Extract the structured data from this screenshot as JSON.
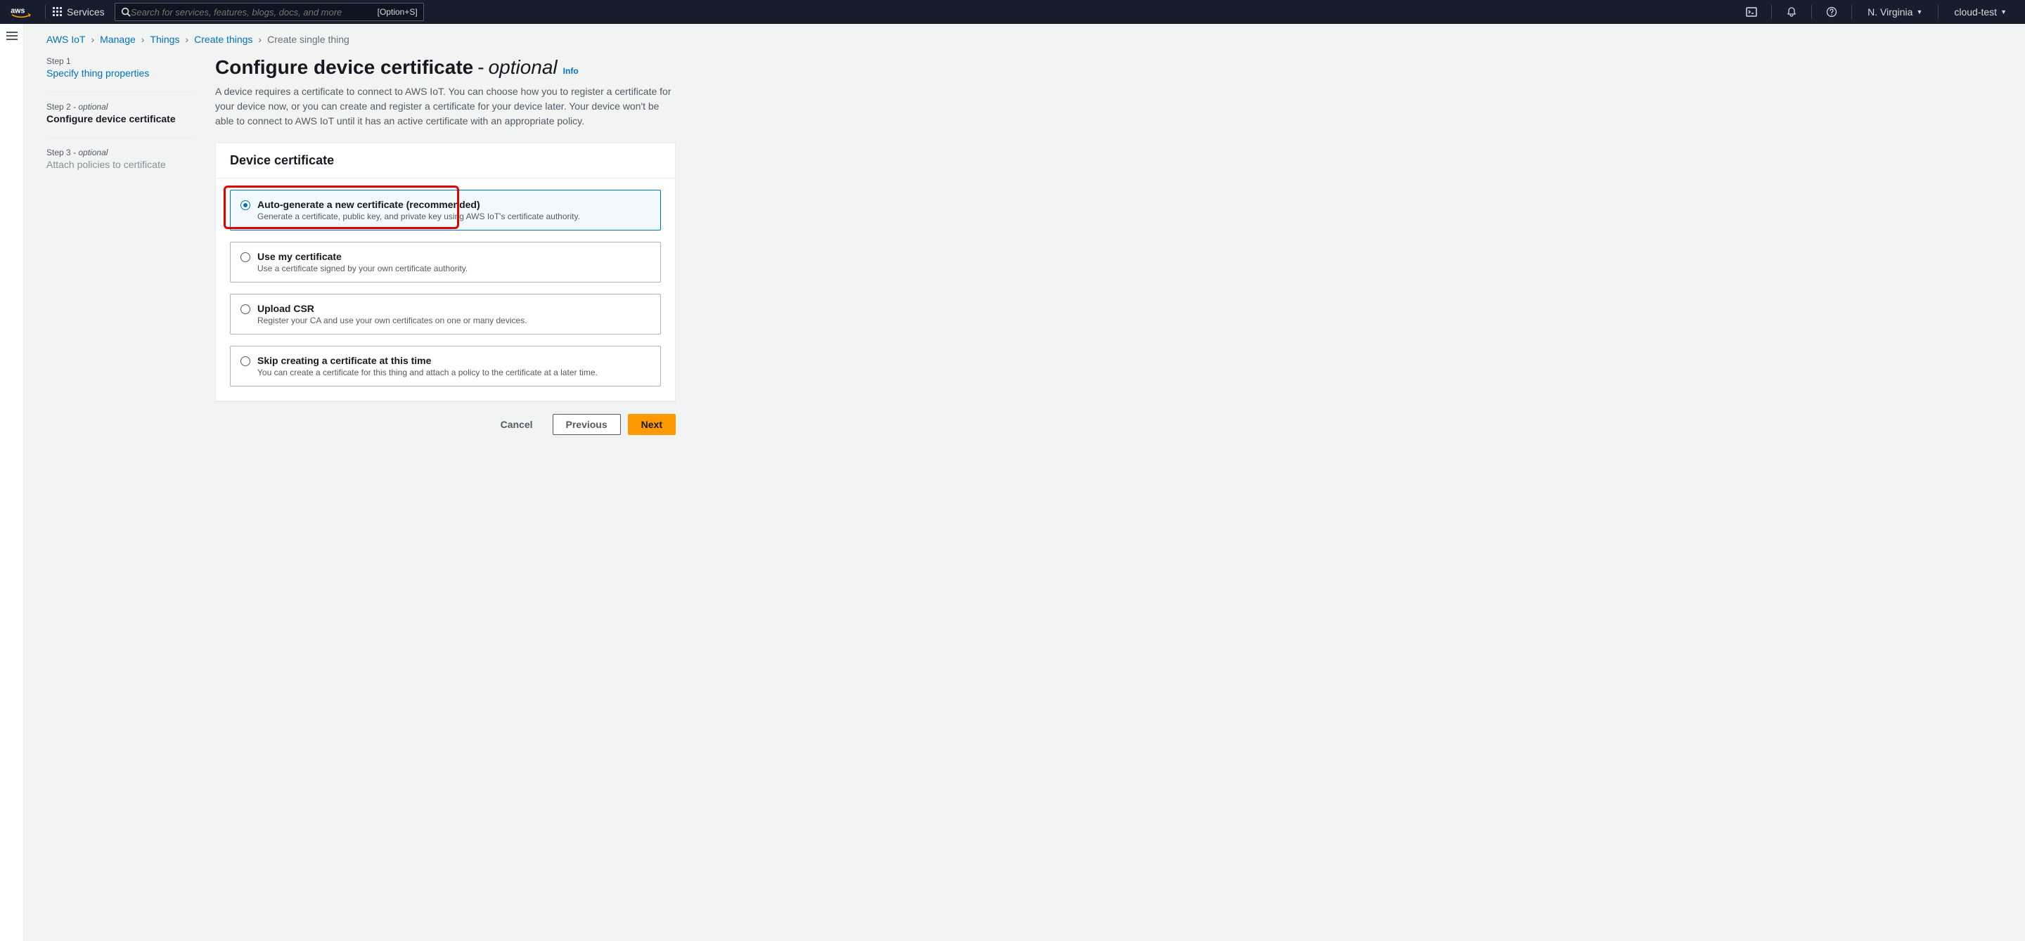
{
  "nav": {
    "services_label": "Services",
    "search_placeholder": "Search for services, features, blogs, docs, and more",
    "search_shortcut": "[Option+S]",
    "region": "N. Virginia",
    "account": "cloud-test"
  },
  "breadcrumbs": {
    "items": [
      "AWS IoT",
      "Manage",
      "Things",
      "Create things"
    ],
    "current": "Create single thing"
  },
  "steps": {
    "s1_label": "Step 1",
    "s1_name": "Specify thing properties",
    "s2_label": "Step 2",
    "s2_opt": "- optional",
    "s2_name": "Configure device certificate",
    "s3_label": "Step 3",
    "s3_opt": "- optional",
    "s3_name": "Attach policies to certificate"
  },
  "page": {
    "title_prefix": "Configure device certificate",
    "title_dash": " - ",
    "title_optional": "optional",
    "info": "Info",
    "description": "A device requires a certificate to connect to AWS IoT. You can choose how you to register a certificate for your device now, or you can create and register a certificate for your device later. Your device won't be able to connect to AWS IoT until it has an active certificate with an appropriate policy."
  },
  "panel": {
    "header": "Device certificate",
    "options": [
      {
        "title": "Auto-generate a new certificate (recommended)",
        "desc": "Generate a certificate, public key, and private key using AWS IoT's certificate authority."
      },
      {
        "title": "Use my certificate",
        "desc": "Use a certificate signed by your own certificate authority."
      },
      {
        "title": "Upload CSR",
        "desc": "Register your CA and use your own certificates on one or many devices."
      },
      {
        "title": "Skip creating a certificate at this time",
        "desc": "You can create a certificate for this thing and attach a policy to the certificate at a later time."
      }
    ]
  },
  "actions": {
    "cancel": "Cancel",
    "previous": "Previous",
    "next": "Next"
  }
}
